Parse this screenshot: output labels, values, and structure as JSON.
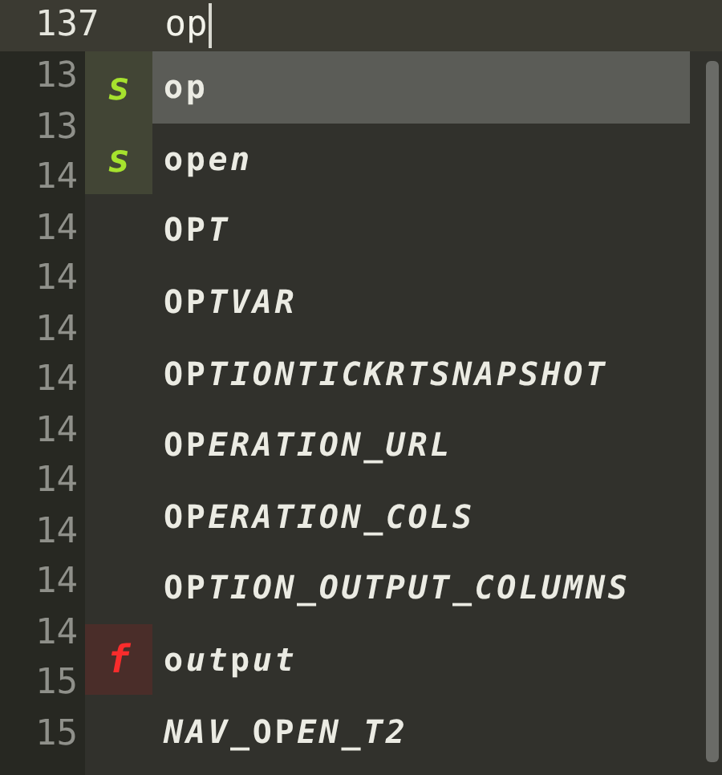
{
  "editor": {
    "current_line": {
      "number": "137",
      "text": "op"
    },
    "gutter_numbers": [
      "13",
      "13",
      "14",
      "14",
      "14",
      "14",
      "14",
      "14",
      "14",
      "14",
      "14",
      "14",
      "15",
      "15"
    ]
  },
  "completions": {
    "items": [
      {
        "kind": "snippet",
        "badge": "s",
        "selected": true,
        "segments": [
          {
            "text": "op",
            "matched": true
          }
        ]
      },
      {
        "kind": "snippet",
        "badge": "s",
        "selected": false,
        "segments": [
          {
            "text": "op",
            "matched": true
          },
          {
            "text": "en",
            "matched": false
          }
        ]
      },
      {
        "kind": "word",
        "selected": false,
        "segments": [
          {
            "text": "OP",
            "matched": true
          },
          {
            "text": "T",
            "matched": false
          }
        ]
      },
      {
        "kind": "word",
        "selected": false,
        "segments": [
          {
            "text": "OP",
            "matched": true
          },
          {
            "text": "TVAR",
            "matched": false
          }
        ]
      },
      {
        "kind": "word",
        "selected": false,
        "segments": [
          {
            "text": "OP",
            "matched": true
          },
          {
            "text": "TIONTICKRTSNAPSHOT",
            "matched": false
          }
        ]
      },
      {
        "kind": "word",
        "selected": false,
        "segments": [
          {
            "text": "OP",
            "matched": true
          },
          {
            "text": "ERATION_URL",
            "matched": false
          }
        ]
      },
      {
        "kind": "word",
        "selected": false,
        "segments": [
          {
            "text": "OP",
            "matched": true
          },
          {
            "text": "ERATION_COLS",
            "matched": false
          }
        ]
      },
      {
        "kind": "word",
        "selected": false,
        "segments": [
          {
            "text": "OP",
            "matched": true
          },
          {
            "text": "TION_OUTPUT_COLUMNS",
            "matched": false
          }
        ]
      },
      {
        "kind": "function",
        "badge": "f",
        "selected": false,
        "segments": [
          {
            "text": "o",
            "matched": true
          },
          {
            "text": "ut",
            "matched": false
          },
          {
            "text": "p",
            "matched": true
          },
          {
            "text": "ut",
            "matched": false
          }
        ]
      },
      {
        "kind": "word",
        "selected": false,
        "segments": [
          {
            "text": "NAV_",
            "matched": false
          },
          {
            "text": "OP",
            "matched": true
          },
          {
            "text": "EN_T2",
            "matched": false
          }
        ]
      }
    ]
  }
}
